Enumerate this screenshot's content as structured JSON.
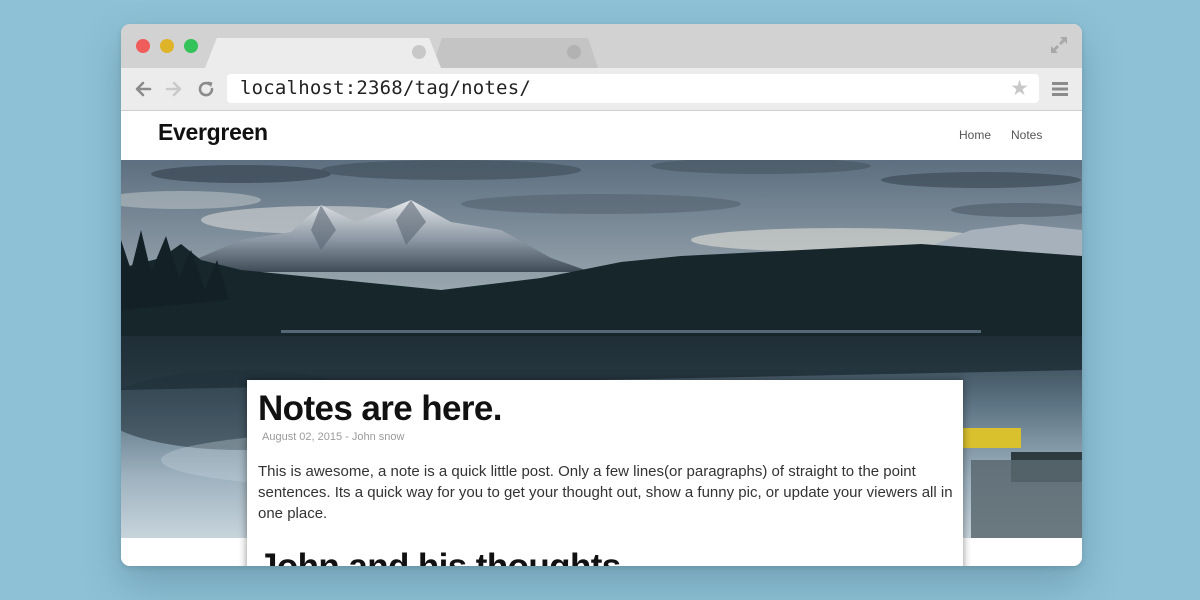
{
  "browser": {
    "url": "localhost:2368/tag/notes/",
    "icons": {
      "back": "arrow-left-icon",
      "forward": "arrow-right-icon",
      "reload": "reload-icon",
      "bookmark": "star-icon",
      "menu": "hamburger-menu-icon",
      "expand": "fullscreen-expand-icon"
    },
    "star_glyph": "★"
  },
  "site": {
    "title": "Evergreen",
    "nav": [
      "Home",
      "Notes"
    ]
  },
  "posts": [
    {
      "title": "Notes are here.",
      "meta": "August 02, 2015 - John snow",
      "body": "This is awesome, a note is a quick little post. Only a few lines(or paragraphs) of straight to the point sentences. Its a quick way for you to get your thought out, show a funny pic, or update your viewers all in one place."
    },
    {
      "title": "John and his thoughts"
    }
  ],
  "colors": {
    "background": "#8ec1d6",
    "window_chrome": "#d2d2d2",
    "toolbar": "#ececec",
    "traffic_red": "#ee5c5b",
    "traffic_yellow": "#e0b428",
    "traffic_green": "#34c25a"
  }
}
